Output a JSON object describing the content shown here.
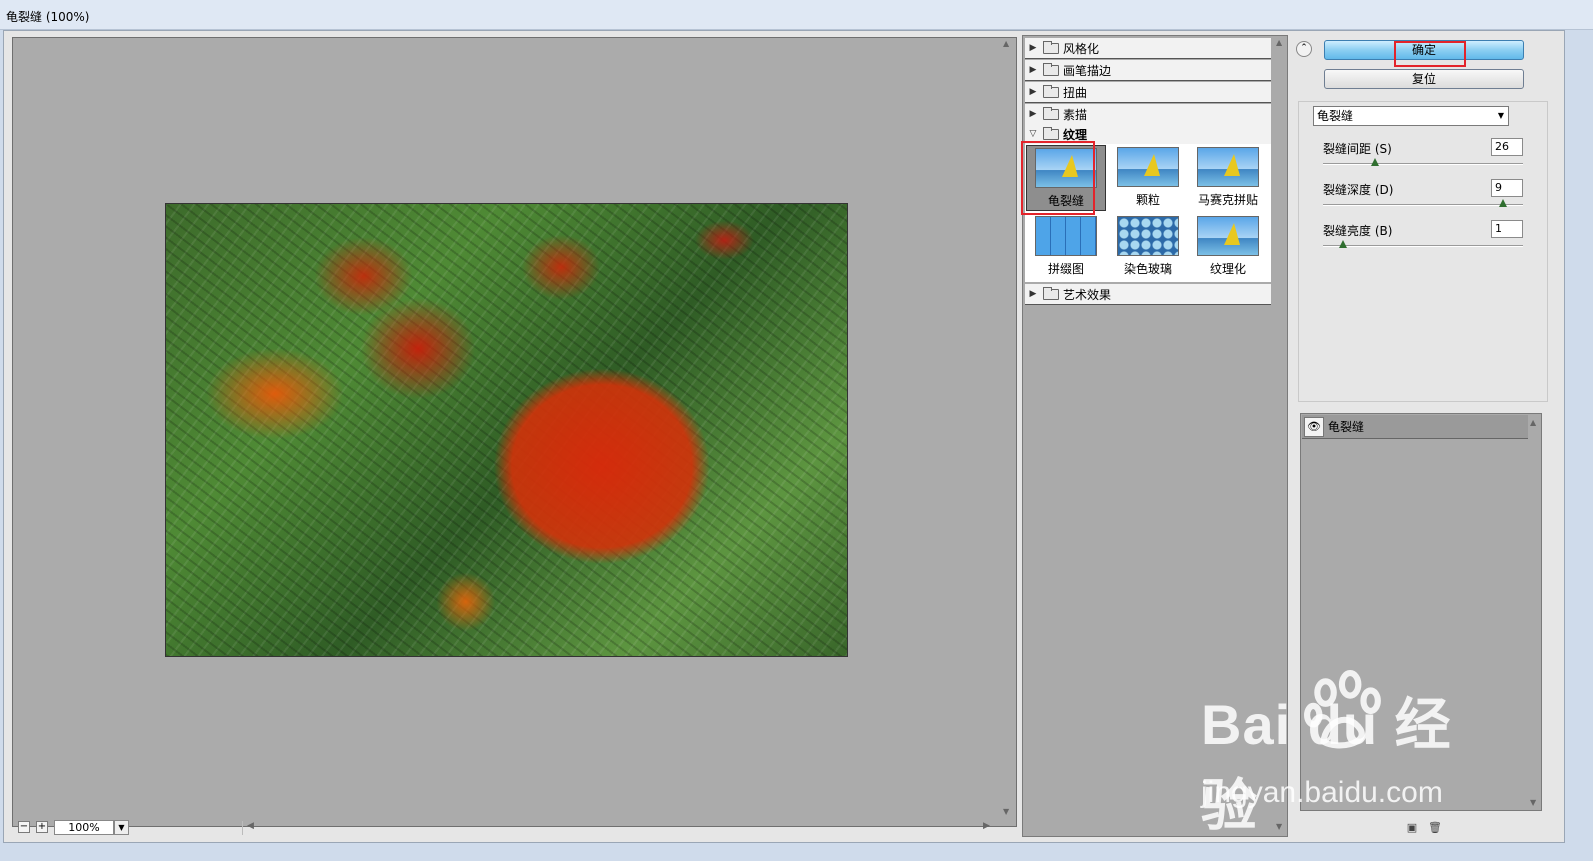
{
  "window": {
    "title": "龟裂缝 (100%)"
  },
  "preview": {
    "zoom": "100%"
  },
  "filter_categories": [
    {
      "label": "风格化",
      "expanded": false
    },
    {
      "label": "画笔描边",
      "expanded": false
    },
    {
      "label": "扭曲",
      "expanded": false
    },
    {
      "label": "素描",
      "expanded": false
    },
    {
      "label": "纹理",
      "expanded": true
    },
    {
      "label": "艺术效果",
      "expanded": false
    }
  ],
  "texture_filters": [
    {
      "label": "龟裂缝",
      "icon": "sailboat-thumb",
      "selected": true
    },
    {
      "label": "颗粒",
      "icon": "sailboat-thumb"
    },
    {
      "label": "马赛克拼贴",
      "icon": "sailboat-thumb"
    },
    {
      "label": "拼缀图",
      "icon": "tile-thumb"
    },
    {
      "label": "染色玻璃",
      "icon": "glass-thumb"
    },
    {
      "label": "纹理化",
      "icon": "sailboat-thumb"
    }
  ],
  "buttons": {
    "ok": "确定",
    "reset": "复位"
  },
  "filter_select": {
    "value": "龟裂缝"
  },
  "params": [
    {
      "label": "裂缝间距 (S)",
      "value": "26",
      "level": 0.26
    },
    {
      "label": "裂缝深度 (D)",
      "value": "9",
      "level": 0.9
    },
    {
      "label": "裂缝亮度 (B)",
      "value": "1",
      "level": 0.1
    }
  ],
  "layers": [
    {
      "name": "龟裂缝",
      "visible": true
    }
  ],
  "watermark": {
    "brand": "Bai du 经验",
    "url": "jingyan.baidu.com"
  },
  "colors": {
    "highlight": "#e3242b",
    "ok_button": "#8ccff2"
  }
}
